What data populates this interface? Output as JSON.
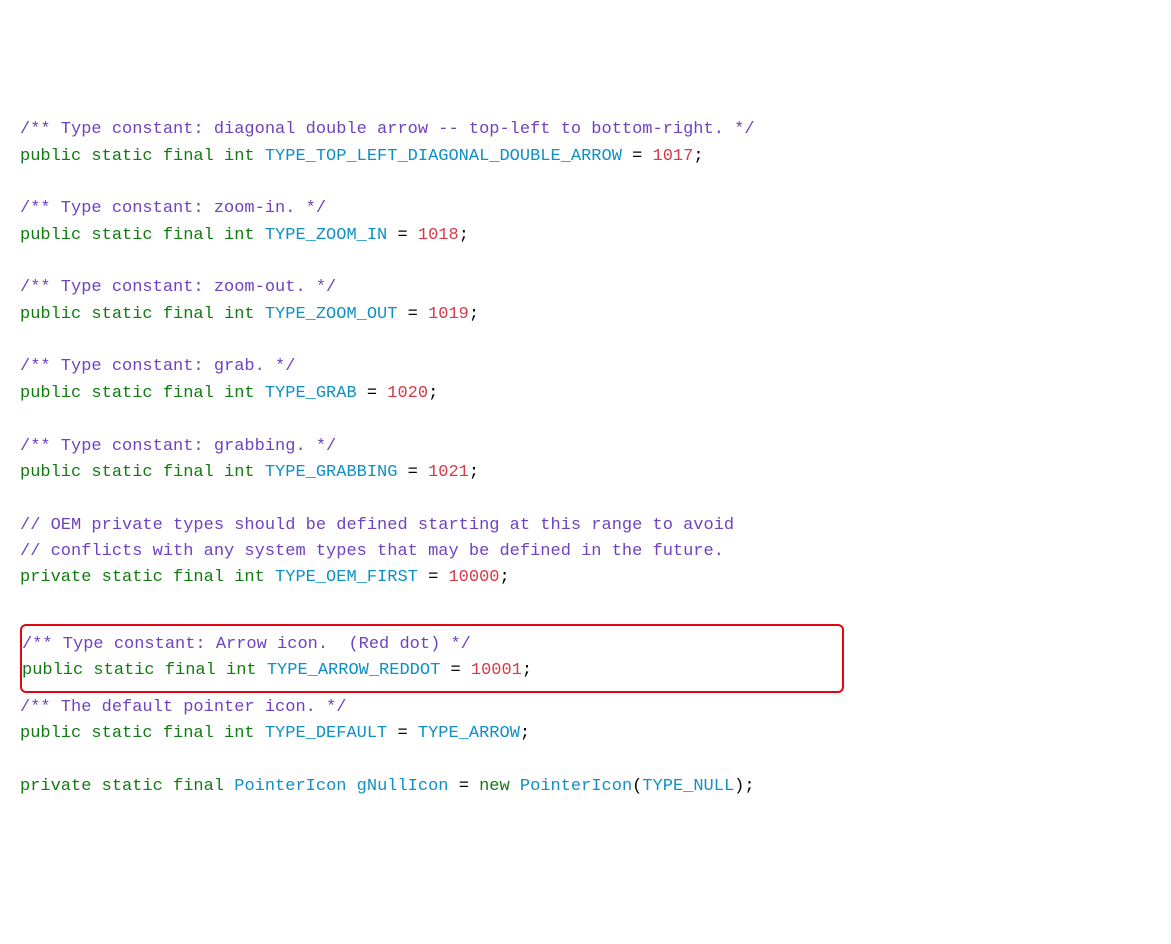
{
  "lines": {
    "c1": "/** Type constant: diagonal double arrow -- top-left to bottom-right. */",
    "l1_pre": "public static final int ",
    "l1_id": "TYPE_TOP_LEFT_DIAGONAL_DOUBLE_ARROW",
    "l1_eq": " = ",
    "l1_val": "1017",
    "l1_end": ";",
    "c2": "/** Type constant: zoom-in. */",
    "l2_pre": "public static final int ",
    "l2_id": "TYPE_ZOOM_IN",
    "l2_eq": " = ",
    "l2_val": "1018",
    "l2_end": ";",
    "c3": "/** Type constant: zoom-out. */",
    "l3_pre": "public static final int ",
    "l3_id": "TYPE_ZOOM_OUT",
    "l3_eq": " = ",
    "l3_val": "1019",
    "l3_end": ";",
    "c4": "/** Type constant: grab. */",
    "l4_pre": "public static final int ",
    "l4_id": "TYPE_GRAB",
    "l4_eq": " = ",
    "l4_val": "1020",
    "l4_end": ";",
    "c5": "/** Type constant: grabbing. */",
    "l5_pre": "public static final int ",
    "l5_id": "TYPE_GRABBING",
    "l5_eq": " = ",
    "l5_val": "1021",
    "l5_end": ";",
    "oem1": "// OEM private types should be defined starting at this range to avoid",
    "oem2": "// conflicts with any system types that may be defined in the future.",
    "l6_pre": "private static final int ",
    "l6_id": "TYPE_OEM_FIRST",
    "l6_eq": " = ",
    "l6_val": "10000",
    "l6_end": ";",
    "cbox": "/** Type constant: Arrow icon.  (Red dot) */",
    "lbox_pre": "public static final int ",
    "lbox_id": "TYPE_ARROW_REDDOT",
    "lbox_eq": " = ",
    "lbox_val": "10001",
    "lbox_end": ";",
    "c7": "/** The default pointer icon. */",
    "l7_pre": "public static final int ",
    "l7_id": "TYPE_DEFAULT",
    "l7_eq": " = ",
    "l7_id2": "TYPE_ARROW",
    "l7_end": ";",
    "l8_pre": "private static final ",
    "l8_type": "PointerIcon",
    "l8_sp": " ",
    "l8_id": "gNullIcon",
    "l8_eq": " = ",
    "l8_new": "new ",
    "l8_ctor": "PointerIcon",
    "l8_open": "(",
    "l8_arg": "TYPE_NULL",
    "l8_close": ");"
  }
}
